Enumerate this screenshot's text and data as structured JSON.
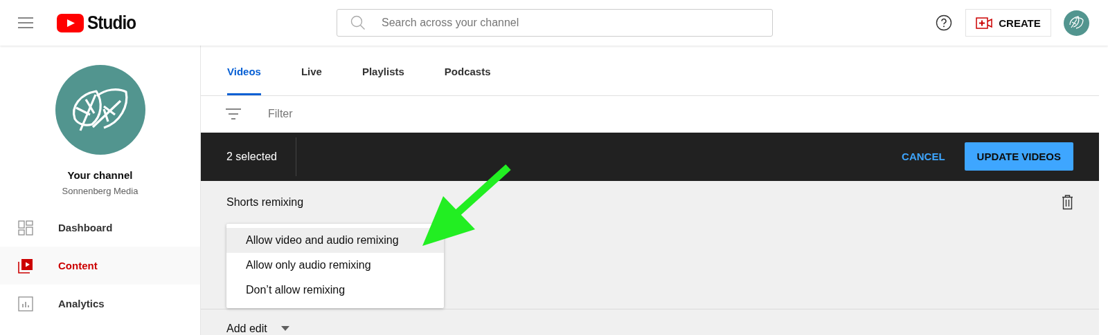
{
  "header": {
    "logo_text": "Studio",
    "search": {
      "placeholder": "Search across your channel"
    },
    "create_button": "CREATE"
  },
  "sidebar": {
    "channel_title": "Your channel",
    "channel_name": "Sonnenberg Media",
    "items": [
      {
        "label": "Dashboard",
        "selected": false
      },
      {
        "label": "Content",
        "selected": true
      },
      {
        "label": "Analytics",
        "selected": false
      }
    ]
  },
  "tabs": [
    {
      "label": "Videos",
      "selected": true
    },
    {
      "label": "Live",
      "selected": false
    },
    {
      "label": "Playlists",
      "selected": false
    },
    {
      "label": "Podcasts",
      "selected": false
    }
  ],
  "filter": {
    "placeholder": "Filter"
  },
  "selection_bar": {
    "count": "2 selected",
    "buttons": [
      {
        "label": "CANCEL",
        "kind": "text"
      },
      {
        "label": "UPDATE VIDEOS",
        "kind": "filled"
      }
    ]
  },
  "edit_panel": {
    "title": "Shorts remixing",
    "options": [
      {
        "label": "Allow video and audio remixing",
        "selected": true
      },
      {
        "label": "Allow only audio remixing",
        "selected": false
      },
      {
        "label": "Don’t allow remixing",
        "selected": false
      }
    ],
    "add_edit": "Add edit"
  }
}
